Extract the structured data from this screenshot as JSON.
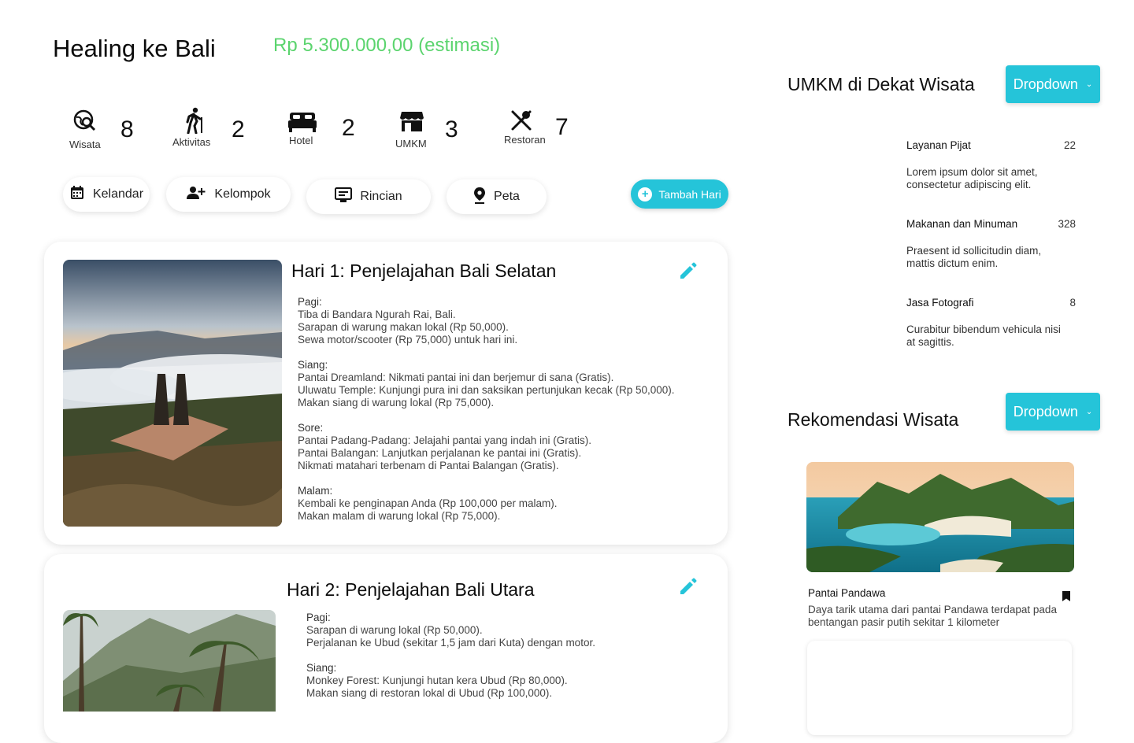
{
  "trip": {
    "title": "Healing ke Bali",
    "budget": "Rp 5.300.000,00 (estimasi)"
  },
  "stats": [
    {
      "icon": "travel-explore-icon",
      "label": "Wisata",
      "value": "8"
    },
    {
      "icon": "hiking-icon",
      "label": "Aktivitas",
      "value": "2"
    },
    {
      "icon": "bed-icon",
      "label": "Hotel",
      "value": "2"
    },
    {
      "icon": "storefront-icon",
      "label": "UMKM",
      "value": "3"
    },
    {
      "icon": "restaurant-icon",
      "label": "Restoran",
      "value": "7"
    }
  ],
  "tabs": {
    "calendar": "Kelandar",
    "group": "Kelompok",
    "details": "Rincian",
    "map": "Peta"
  },
  "add_day_label": "Tambah Hari",
  "days": [
    {
      "title": "Hari 1: Penjelajahan Bali Selatan",
      "sections": [
        {
          "title": "Pagi:",
          "lines": [
            "Tiba di Bandara Ngurah Rai, Bali.",
            "Sarapan di warung makan lokal (Rp 50,000).",
            "Sewa motor/scooter (Rp 75,000) untuk hari ini."
          ]
        },
        {
          "title": "Siang:",
          "lines": [
            "Pantai Dreamland: Nikmati pantai ini dan berjemur di sana (Gratis).",
            "Uluwatu Temple: Kunjungi pura ini dan saksikan pertunjukan kecak (Rp 50,000).",
            "Makan siang di warung lokal (Rp 75,000)."
          ]
        },
        {
          "title": "Sore:",
          "lines": [
            "Pantai Padang-Padang: Jelajahi pantai yang indah ini (Gratis).",
            "Pantai Balangan: Lanjutkan perjalanan ke pantai ini (Gratis).",
            "Nikmati matahari terbenam di Pantai Balangan (Gratis)."
          ]
        },
        {
          "title": "Malam:",
          "lines": [
            "Kembali ke penginapan Anda (Rp 100,000 per malam).",
            "Makan malam di warung lokal (Rp 75,000)."
          ]
        }
      ]
    },
    {
      "title": "Hari 2: Penjelajahan Bali Utara",
      "sections": [
        {
          "title": "Pagi:",
          "lines": [
            "Sarapan di warung lokal (Rp 50,000).",
            "Perjalanan ke Ubud (sekitar 1,5 jam dari Kuta) dengan motor."
          ]
        },
        {
          "title": "Siang:",
          "lines": [
            "Monkey Forest: Kunjungi hutan kera Ubud (Rp 80,000).",
            "Makan siang di restoran lokal di Ubud (Rp 100,000)."
          ]
        }
      ]
    }
  ],
  "umkm": {
    "title": "UMKM di Dekat Wisata",
    "dropdown": "Dropdown",
    "items": [
      {
        "name": "Layanan Pijat",
        "count": "22",
        "desc": "Lorem ipsum dolor sit amet, consectetur adipiscing elit."
      },
      {
        "name": "Makanan dan Minuman",
        "count": "328",
        "desc": "Praesent id sollicitudin diam, mattis dictum enim."
      },
      {
        "name": "Jasa Fotografi",
        "count": "8",
        "desc": "Curabitur bibendum vehicula nisi at sagittis."
      }
    ]
  },
  "recommendation": {
    "title": "Rekomendasi Wisata",
    "dropdown": "Dropdown",
    "item": {
      "name": "Pantai Pandawa",
      "desc": "Daya tarik utama dari pantai Pandawa terdapat pada bentangan pasir putih sekitar 1 kilometer"
    }
  },
  "colors": {
    "accent": "#25c4d9",
    "budget": "#5bd46e"
  }
}
